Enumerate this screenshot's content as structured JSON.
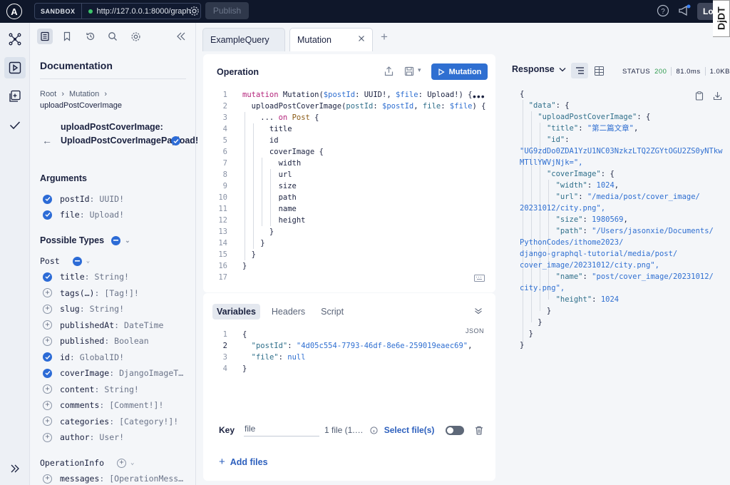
{
  "topbar": {
    "logo_letter": "A",
    "sandbox_label": "SANDBOX",
    "url": "http://127.0.0.1:8000/graph",
    "publish_label": "Publish",
    "login_label": "Log",
    "djdt_label": "DjDT"
  },
  "docs": {
    "title": "Documentation",
    "breadcrumb_root": "Root",
    "breadcrumb_sep1": "›",
    "breadcrumb_mutation": "Mutation",
    "breadcrumb_sep2": "›",
    "breadcrumb_field": "uploadPostCoverImage",
    "field_title": "uploadPostCoverImage: UploadPostCoverImagePayload!",
    "arguments_title": "Arguments",
    "arguments": [
      {
        "name": "postId",
        "type": "UUID!"
      },
      {
        "name": "file",
        "type": "Upload!"
      }
    ],
    "possible_types_title": "Possible Types",
    "post_type_label": "Post",
    "post_fields": [
      {
        "name": "title",
        "type": "String!",
        "checked": true
      },
      {
        "name": "tags(…)",
        "type": "[Tag!]!",
        "checked": false
      },
      {
        "name": "slug",
        "type": "String!",
        "checked": false
      },
      {
        "name": "publishedAt",
        "type": "DateTime",
        "checked": false
      },
      {
        "name": "published",
        "type": "Boolean",
        "checked": false
      },
      {
        "name": "id",
        "type": "GlobalID!",
        "checked": true
      },
      {
        "name": "coverImage",
        "type": "DjangoImageT…",
        "checked": true
      },
      {
        "name": "content",
        "type": "String!",
        "checked": false
      },
      {
        "name": "comments",
        "type": "[Comment!]!",
        "checked": false
      },
      {
        "name": "categories",
        "type": "[Category!]!",
        "checked": false
      },
      {
        "name": "author",
        "type": "User!",
        "checked": false
      }
    ],
    "operation_info_label": "OperationInfo",
    "operation_info_field": {
      "name": "messages",
      "type": "[OperationMess…"
    }
  },
  "tabs": [
    {
      "label": "ExampleQuery"
    },
    {
      "label": "Mutation"
    }
  ],
  "operation": {
    "title": "Operation",
    "run_label": "Mutation",
    "lines": [
      {
        "n": "1",
        "t": "mutation Mutation($postId: UUID!, $file: Upload!) {"
      },
      {
        "n": "2",
        "t": "  uploadPostCoverImage(postId: $postId, file: $file) {"
      },
      {
        "n": "3",
        "t": "    ... on Post {"
      },
      {
        "n": "4",
        "t": "      title"
      },
      {
        "n": "5",
        "t": "      id"
      },
      {
        "n": "6",
        "t": "      coverImage {"
      },
      {
        "n": "7",
        "t": "        width"
      },
      {
        "n": "8",
        "t": "        url"
      },
      {
        "n": "9",
        "t": "        size"
      },
      {
        "n": "10",
        "t": "        path"
      },
      {
        "n": "11",
        "t": "        name"
      },
      {
        "n": "12",
        "t": "        height"
      },
      {
        "n": "13",
        "t": "      }"
      },
      {
        "n": "14",
        "t": "    }"
      },
      {
        "n": "15",
        "t": "  }"
      },
      {
        "n": "16",
        "t": "}"
      },
      {
        "n": "17",
        "t": ""
      }
    ]
  },
  "variables": {
    "tabs": [
      "Variables",
      "Headers",
      "Script"
    ],
    "json_label": "JSON",
    "lines": [
      {
        "n": "1",
        "t": "{"
      },
      {
        "n": "2",
        "t": "  \"postId\": \"4d05c554-7793-46df-8e6e-259019eaec69\","
      },
      {
        "n": "3",
        "t": "  \"file\": null"
      },
      {
        "n": "4",
        "t": "}"
      }
    ],
    "key_label": "Key",
    "key_value": "file",
    "file_count": "1 file (1.…",
    "select_files_label": "Select file(s)",
    "add_files_label": "Add files"
  },
  "response": {
    "title": "Response",
    "status_label": "STATUS",
    "status_code": "200",
    "time": "81.0ms",
    "size": "1.0KB",
    "lines": [
      "{",
      "  \"data\": {",
      "    \"uploadPostCoverImage\": {",
      "      \"title\": \"第二篇文章\",",
      "      \"id\":",
      "\"UG9zdDo0ZDA1YzU1NC03NzkzLTQ2ZGYtOGU2ZS0yNTkw",
      "MTllYWVjNjk=\",",
      "      \"coverImage\": {",
      "        \"width\": 1024,",
      "        \"url\": \"/media/post/cover_image/",
      "20231012/city.png\",",
      "        \"size\": 1980569,",
      "        \"path\": \"/Users/jasonxie/Documents/",
      "PythonCodes/ithome2023/",
      "django-graphql-tutorial/media/post/",
      "cover_image/20231012/city.png\",",
      "        \"name\": \"post/cover_image/20231012/",
      "city.png\",",
      "        \"height\": 1024",
      "      }",
      "    }",
      "  }",
      "}"
    ]
  },
  "colors": {
    "accent": "#2f6fd1",
    "topbar": "#0f172a",
    "status_ok": "#2e9b4e"
  }
}
